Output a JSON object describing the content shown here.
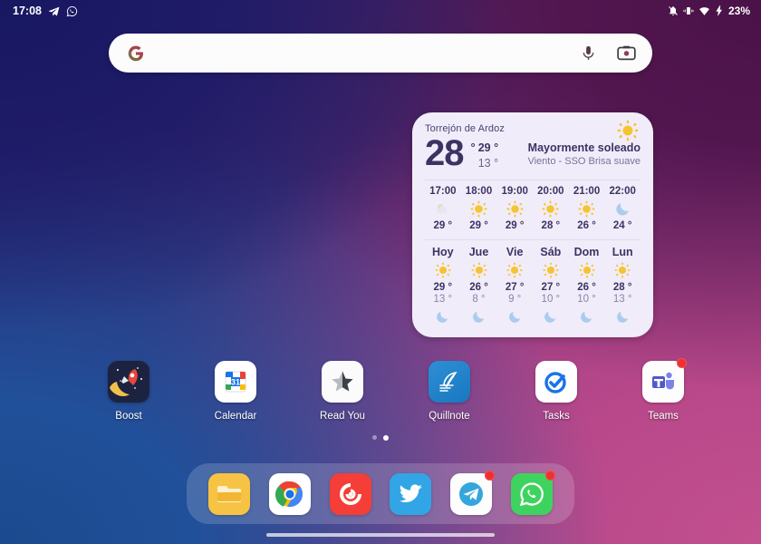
{
  "status_bar": {
    "time": "17:08",
    "battery": "23%",
    "left_icons": [
      "telegram-icon",
      "whatsapp-icon"
    ],
    "right_icons": [
      "notifications-silenced-icon",
      "vibrate-icon",
      "wifi-icon",
      "charging-bolt-icon"
    ]
  },
  "search": {
    "value": "",
    "placeholder": "",
    "logo": "google-g-icon",
    "mic": "microphone-icon",
    "lens": "google-lens-camera-icon"
  },
  "weather": {
    "city": "Torrejón de Ardoz",
    "temp": "28",
    "degree_mark": "°",
    "high": "29 °",
    "low": "13 °",
    "condition": "Mayormente soleado",
    "wind": "Viento - SSO Brisa suave",
    "condition_icon": "sun-icon",
    "hourly": [
      {
        "time": "17:00",
        "icon": "partly-cloudy-icon",
        "temp": "29 °"
      },
      {
        "time": "18:00",
        "icon": "sun-icon",
        "temp": "29 °"
      },
      {
        "time": "19:00",
        "icon": "sun-icon",
        "temp": "29 °"
      },
      {
        "time": "20:00",
        "icon": "sun-icon",
        "temp": "28 °"
      },
      {
        "time": "21:00",
        "icon": "sun-icon",
        "temp": "26 °"
      },
      {
        "time": "22:00",
        "icon": "moon-icon",
        "temp": "24 °"
      }
    ],
    "daily": [
      {
        "day": "Hoy",
        "icon": "sun-icon",
        "high": "29 °",
        "low": "13 °",
        "night_icon": "moon-icon"
      },
      {
        "day": "Jue",
        "icon": "sun-icon",
        "high": "26 °",
        "low": "8 °",
        "night_icon": "moon-icon"
      },
      {
        "day": "Vie",
        "icon": "sun-icon",
        "high": "27 °",
        "low": "9 °",
        "night_icon": "moon-icon"
      },
      {
        "day": "Sáb",
        "icon": "sun-icon",
        "high": "27 °",
        "low": "10 °",
        "night_icon": "moon-icon"
      },
      {
        "day": "Dom",
        "icon": "sun-icon",
        "high": "26 °",
        "low": "10 °",
        "night_icon": "moon-icon"
      },
      {
        "day": "Lun",
        "icon": "sun-icon",
        "high": "28 °",
        "low": "13 °",
        "night_icon": "moon-icon"
      }
    ]
  },
  "apps": [
    {
      "label": "Boost",
      "icon": "boost-rocket-icon",
      "badge": false
    },
    {
      "label": "Calendar",
      "icon": "google-calendar-icon",
      "badge": false
    },
    {
      "label": "Read You",
      "icon": "read-you-star-icon",
      "badge": false
    },
    {
      "label": "Quillnote",
      "icon": "quillnote-quill-icon",
      "badge": false
    },
    {
      "label": "Tasks",
      "icon": "google-tasks-icon",
      "badge": false
    },
    {
      "label": "Teams",
      "icon": "microsoft-teams-icon",
      "badge": true
    }
  ],
  "page_indicator": {
    "count": 2,
    "active": 1
  },
  "dock": [
    {
      "name": "Files",
      "icon": "files-folder-icon",
      "badge": false
    },
    {
      "name": "Chrome",
      "icon": "chrome-icon",
      "badge": false
    },
    {
      "name": "Pocket Casts",
      "icon": "pocket-casts-icon",
      "badge": false
    },
    {
      "name": "Twitter",
      "icon": "twitter-bird-icon",
      "badge": false
    },
    {
      "name": "Telegram",
      "icon": "telegram-icon",
      "badge": true
    },
    {
      "name": "WhatsApp",
      "icon": "whatsapp-icon",
      "badge": true
    }
  ],
  "colors": {
    "widget_bg": "#f1ecf9",
    "widget_text": "#3b3463",
    "badge": "#f03030",
    "wallpaper_top_left": "#1d1a66",
    "wallpaper_bottom_right": "#c2508f"
  }
}
